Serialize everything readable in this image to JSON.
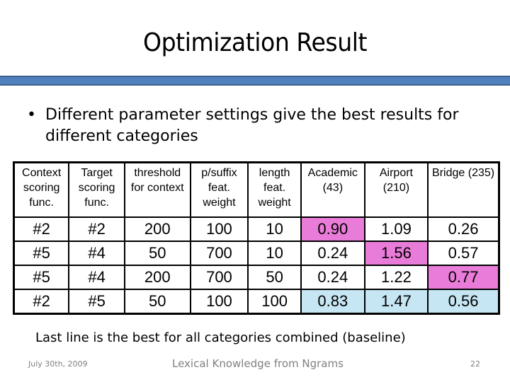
{
  "slide": {
    "title": "Optimization Result",
    "bullet": "Different parameter settings give the best results for different categories",
    "note": "Last line is the best for all categories combined (baseline)"
  },
  "table": {
    "headers": [
      "Context scoring func.",
      "Target scoring func.",
      "threshold for context",
      "p/suffix feat. weight",
      "length feat. weight",
      "Academic (43)",
      "Airport (210)",
      "Bridge (235)"
    ],
    "rows": [
      {
        "cells": [
          "#2",
          "#2",
          "200",
          "100",
          "10",
          "0.90",
          "1.09",
          "0.26"
        ],
        "highlight": [
          "",
          "",
          "",
          "",
          "",
          "best",
          "",
          ""
        ]
      },
      {
        "cells": [
          "#5",
          "#4",
          "50",
          "700",
          "10",
          "0.24",
          "1.56",
          "0.57"
        ],
        "highlight": [
          "",
          "",
          "",
          "",
          "",
          "",
          "best",
          ""
        ]
      },
      {
        "cells": [
          "#5",
          "#4",
          "200",
          "700",
          "50",
          "0.24",
          "1.22",
          "0.77"
        ],
        "highlight": [
          "",
          "",
          "",
          "",
          "",
          "",
          "",
          "best"
        ]
      },
      {
        "cells": [
          "#2",
          "#5",
          "50",
          "100",
          "100",
          "0.83",
          "1.47",
          "0.56"
        ],
        "highlight": [
          "",
          "",
          "",
          "",
          "",
          "base",
          "base",
          "base"
        ]
      }
    ],
    "colors": {
      "best": "#e97cd8",
      "baseline": "#c6e6f3"
    }
  },
  "footer": {
    "date": "July 30th, 2009",
    "title": "Lexical Knowledge from Ngrams",
    "page": "22"
  },
  "theme": {
    "accent_bar": "#4f81bd"
  }
}
